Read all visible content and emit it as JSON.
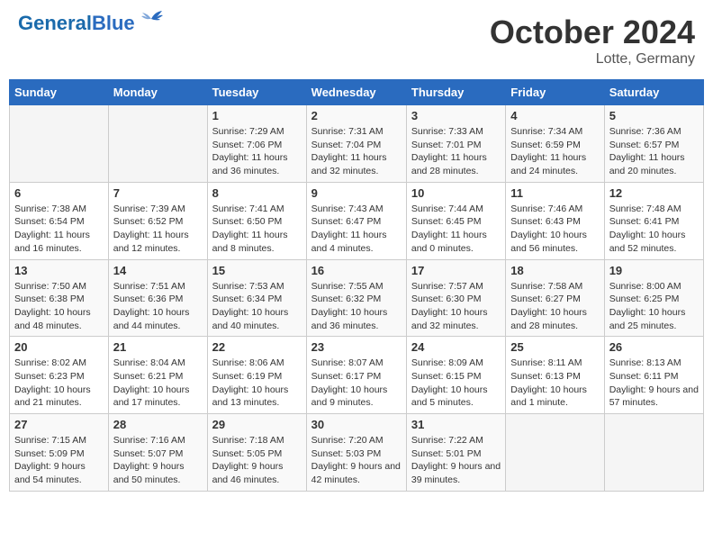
{
  "header": {
    "logo_general": "General",
    "logo_blue": "Blue",
    "month_title": "October 2024",
    "location": "Lotte, Germany"
  },
  "days_of_week": [
    "Sunday",
    "Monday",
    "Tuesday",
    "Wednesday",
    "Thursday",
    "Friday",
    "Saturday"
  ],
  "weeks": [
    [
      {
        "day": "",
        "info": ""
      },
      {
        "day": "",
        "info": ""
      },
      {
        "day": "1",
        "info": "Sunrise: 7:29 AM\nSunset: 7:06 PM\nDaylight: 11 hours and 36 minutes."
      },
      {
        "day": "2",
        "info": "Sunrise: 7:31 AM\nSunset: 7:04 PM\nDaylight: 11 hours and 32 minutes."
      },
      {
        "day": "3",
        "info": "Sunrise: 7:33 AM\nSunset: 7:01 PM\nDaylight: 11 hours and 28 minutes."
      },
      {
        "day": "4",
        "info": "Sunrise: 7:34 AM\nSunset: 6:59 PM\nDaylight: 11 hours and 24 minutes."
      },
      {
        "day": "5",
        "info": "Sunrise: 7:36 AM\nSunset: 6:57 PM\nDaylight: 11 hours and 20 minutes."
      }
    ],
    [
      {
        "day": "6",
        "info": "Sunrise: 7:38 AM\nSunset: 6:54 PM\nDaylight: 11 hours and 16 minutes."
      },
      {
        "day": "7",
        "info": "Sunrise: 7:39 AM\nSunset: 6:52 PM\nDaylight: 11 hours and 12 minutes."
      },
      {
        "day": "8",
        "info": "Sunrise: 7:41 AM\nSunset: 6:50 PM\nDaylight: 11 hours and 8 minutes."
      },
      {
        "day": "9",
        "info": "Sunrise: 7:43 AM\nSunset: 6:47 PM\nDaylight: 11 hours and 4 minutes."
      },
      {
        "day": "10",
        "info": "Sunrise: 7:44 AM\nSunset: 6:45 PM\nDaylight: 11 hours and 0 minutes."
      },
      {
        "day": "11",
        "info": "Sunrise: 7:46 AM\nSunset: 6:43 PM\nDaylight: 10 hours and 56 minutes."
      },
      {
        "day": "12",
        "info": "Sunrise: 7:48 AM\nSunset: 6:41 PM\nDaylight: 10 hours and 52 minutes."
      }
    ],
    [
      {
        "day": "13",
        "info": "Sunrise: 7:50 AM\nSunset: 6:38 PM\nDaylight: 10 hours and 48 minutes."
      },
      {
        "day": "14",
        "info": "Sunrise: 7:51 AM\nSunset: 6:36 PM\nDaylight: 10 hours and 44 minutes."
      },
      {
        "day": "15",
        "info": "Sunrise: 7:53 AM\nSunset: 6:34 PM\nDaylight: 10 hours and 40 minutes."
      },
      {
        "day": "16",
        "info": "Sunrise: 7:55 AM\nSunset: 6:32 PM\nDaylight: 10 hours and 36 minutes."
      },
      {
        "day": "17",
        "info": "Sunrise: 7:57 AM\nSunset: 6:30 PM\nDaylight: 10 hours and 32 minutes."
      },
      {
        "day": "18",
        "info": "Sunrise: 7:58 AM\nSunset: 6:27 PM\nDaylight: 10 hours and 28 minutes."
      },
      {
        "day": "19",
        "info": "Sunrise: 8:00 AM\nSunset: 6:25 PM\nDaylight: 10 hours and 25 minutes."
      }
    ],
    [
      {
        "day": "20",
        "info": "Sunrise: 8:02 AM\nSunset: 6:23 PM\nDaylight: 10 hours and 21 minutes."
      },
      {
        "day": "21",
        "info": "Sunrise: 8:04 AM\nSunset: 6:21 PM\nDaylight: 10 hours and 17 minutes."
      },
      {
        "day": "22",
        "info": "Sunrise: 8:06 AM\nSunset: 6:19 PM\nDaylight: 10 hours and 13 minutes."
      },
      {
        "day": "23",
        "info": "Sunrise: 8:07 AM\nSunset: 6:17 PM\nDaylight: 10 hours and 9 minutes."
      },
      {
        "day": "24",
        "info": "Sunrise: 8:09 AM\nSunset: 6:15 PM\nDaylight: 10 hours and 5 minutes."
      },
      {
        "day": "25",
        "info": "Sunrise: 8:11 AM\nSunset: 6:13 PM\nDaylight: 10 hours and 1 minute."
      },
      {
        "day": "26",
        "info": "Sunrise: 8:13 AM\nSunset: 6:11 PM\nDaylight: 9 hours and 57 minutes."
      }
    ],
    [
      {
        "day": "27",
        "info": "Sunrise: 7:15 AM\nSunset: 5:09 PM\nDaylight: 9 hours and 54 minutes."
      },
      {
        "day": "28",
        "info": "Sunrise: 7:16 AM\nSunset: 5:07 PM\nDaylight: 9 hours and 50 minutes."
      },
      {
        "day": "29",
        "info": "Sunrise: 7:18 AM\nSunset: 5:05 PM\nDaylight: 9 hours and 46 minutes."
      },
      {
        "day": "30",
        "info": "Sunrise: 7:20 AM\nSunset: 5:03 PM\nDaylight: 9 hours and 42 minutes."
      },
      {
        "day": "31",
        "info": "Sunrise: 7:22 AM\nSunset: 5:01 PM\nDaylight: 9 hours and 39 minutes."
      },
      {
        "day": "",
        "info": ""
      },
      {
        "day": "",
        "info": ""
      }
    ]
  ]
}
